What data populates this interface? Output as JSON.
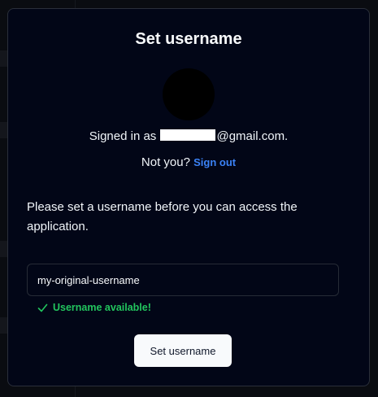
{
  "dialog": {
    "title": "Set username",
    "signed_in_prefix": "Signed in as",
    "signed_in_suffix": "@gmail.com.",
    "not_you_label": "Not you?",
    "sign_out_link": "Sign out",
    "instruction": "Please set a username before you can access the application.",
    "username_value": "my-original-username",
    "availability_message": "Username available!",
    "submit_label": "Set username"
  },
  "icons": {
    "status": "check-icon"
  },
  "colors": {
    "background": "#020617",
    "link": "#3b82f6",
    "success": "#22c55e",
    "button": "#f8fafc"
  }
}
